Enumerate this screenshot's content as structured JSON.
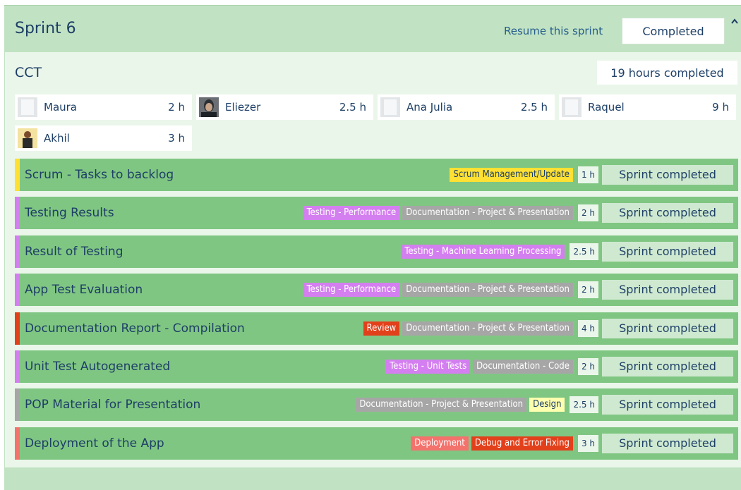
{
  "sprint": {
    "title": "Sprint 6",
    "resume_label": "Resume this sprint",
    "status_label": "Completed"
  },
  "team": {
    "name": "CCT",
    "hours_summary": "19 hours completed",
    "members": [
      {
        "name": "Maura",
        "hours": "2 h",
        "avatar": "placeholder"
      },
      {
        "name": "Eliezer",
        "hours": "2.5 h",
        "avatar": "photo-dark"
      },
      {
        "name": "Ana Julia",
        "hours": "2.5 h",
        "avatar": "placeholder"
      },
      {
        "name": "Raquel",
        "hours": "9 h",
        "avatar": "placeholder"
      },
      {
        "name": "Akhil",
        "hours": "3 h",
        "avatar": "photo-person"
      }
    ]
  },
  "colors": {
    "panel_bg": "#c1e3c3",
    "task_bg": "#80c683",
    "tag_scrum": "#ffe033",
    "tag_testing": "#d47ff0",
    "tag_documentation": "#a6a6a6",
    "tag_review": "#e2401b",
    "tag_design": "#ffffb0",
    "tag_deployment": "#f4726c",
    "tag_debug": "#e2401b"
  },
  "tasks": [
    {
      "title": "Scrum  - Tasks to backlog",
      "stripe": "#ffe033",
      "tags": [
        {
          "label": "Scrum Management/Update",
          "bg": "#ffe033",
          "fg": "#1d3f66"
        }
      ],
      "hours": "1 h",
      "action": "Sprint completed"
    },
    {
      "title": "Testing Results",
      "stripe": "#d47ff0",
      "tags": [
        {
          "label": "Testing - Performance",
          "bg": "#d47ff0",
          "fg": "#ffffff"
        },
        {
          "label": "Documentation - Project & Presentation",
          "bg": "#a6a6a6",
          "fg": "#ffffff"
        }
      ],
      "hours": "2 h",
      "action": "Sprint completed"
    },
    {
      "title": "Result of Testing",
      "stripe": "#d47ff0",
      "tags": [
        {
          "label": "Testing - Machine Learning Processing",
          "bg": "#d47ff0",
          "fg": "#ffffff"
        }
      ],
      "hours": "2.5 h",
      "action": "Sprint completed"
    },
    {
      "title": "App Test Evaluation",
      "stripe": "#d47ff0",
      "tags": [
        {
          "label": "Testing - Performance",
          "bg": "#d47ff0",
          "fg": "#ffffff"
        },
        {
          "label": "Documentation - Project & Presentation",
          "bg": "#a6a6a6",
          "fg": "#ffffff"
        }
      ],
      "hours": "2 h",
      "action": "Sprint completed"
    },
    {
      "title": "Documentation Report - Compilation",
      "stripe": "#e2401b",
      "tags": [
        {
          "label": "Review",
          "bg": "#e2401b",
          "fg": "#ffffff"
        },
        {
          "label": "Documentation - Project & Presentation",
          "bg": "#a6a6a6",
          "fg": "#ffffff"
        }
      ],
      "hours": "4 h",
      "action": "Sprint completed"
    },
    {
      "title": "Unit Test Autogenerated",
      "stripe": "#d47ff0",
      "tags": [
        {
          "label": "Testing - Unit Tests",
          "bg": "#d47ff0",
          "fg": "#ffffff"
        },
        {
          "label": "Documentation - Code",
          "bg": "#a6a6a6",
          "fg": "#ffffff"
        }
      ],
      "hours": "2 h",
      "action": "Sprint completed"
    },
    {
      "title": "POP Material for Presentation",
      "stripe": "#a6a6a6",
      "tags": [
        {
          "label": "Documentation - Project & Presentation",
          "bg": "#a6a6a6",
          "fg": "#ffffff"
        },
        {
          "label": "Design",
          "bg": "#ffffb0",
          "fg": "#1d3f66"
        }
      ],
      "hours": "2.5 h",
      "action": "Sprint completed"
    },
    {
      "title": "Deployment of the App",
      "stripe": "#f4726c",
      "tags": [
        {
          "label": "Deployment",
          "bg": "#f4726c",
          "fg": "#ffffff"
        },
        {
          "label": "Debug and Error Fixing",
          "bg": "#e2401b",
          "fg": "#ffffff"
        }
      ],
      "hours": "3 h",
      "action": "Sprint completed"
    }
  ]
}
